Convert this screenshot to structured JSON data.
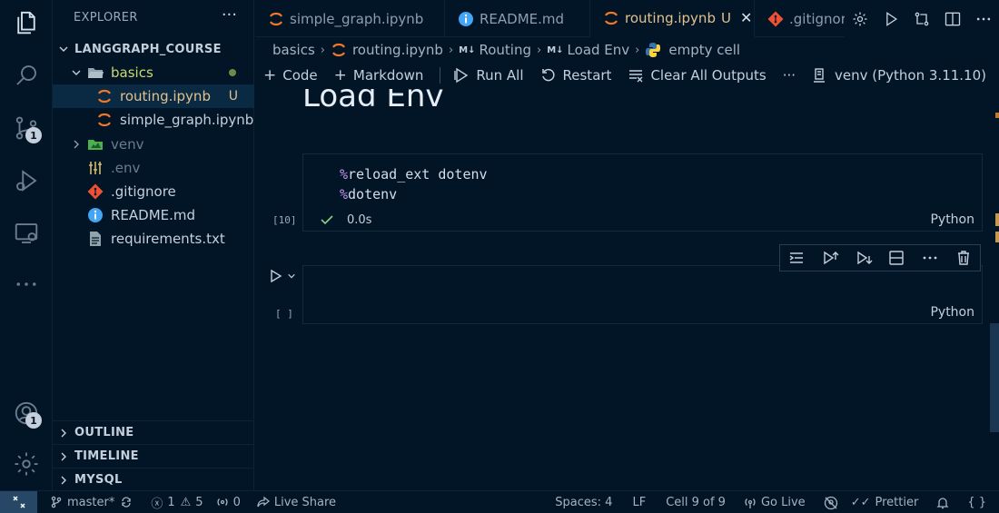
{
  "activity_bar": {
    "source_control_badge": "1",
    "accounts_badge": "1"
  },
  "sidebar": {
    "title": "EXPLORER",
    "root": "LANGGRAPH_COURSE",
    "items": [
      {
        "label": "basics"
      },
      {
        "label": "routing.ipynb",
        "status": "U"
      },
      {
        "label": "simple_graph.ipynb"
      },
      {
        "label": "venv"
      },
      {
        "label": ".env"
      },
      {
        "label": ".gitignore"
      },
      {
        "label": "README.md"
      },
      {
        "label": "requirements.txt"
      }
    ],
    "sections": [
      "OUTLINE",
      "TIMELINE",
      "MYSQL"
    ]
  },
  "tabs": [
    {
      "label": "simple_graph.ipynb"
    },
    {
      "label": "README.md"
    },
    {
      "label": "routing.ipynb",
      "status": "U"
    },
    {
      "label": ".gitignore"
    }
  ],
  "breadcrumb": {
    "folder": "basics",
    "file": "routing.ipynb",
    "md_marker": "M↓",
    "section1": "Routing",
    "section2": "Load Env",
    "cell": "empty cell"
  },
  "notebook_toolbar": {
    "code": "Code",
    "markdown": "Markdown",
    "run_all": "Run All",
    "restart": "Restart",
    "clear_outputs": "Clear All Outputs",
    "more": "···",
    "kernel": "venv (Python 3.11.10)"
  },
  "notebook": {
    "heading": "Load Env",
    "cell1": {
      "line1_magic": "%",
      "line1_rest": "reload_ext dotenv",
      "line2_magic": "%",
      "line2_rest": "dotenv",
      "exec_count": "[10]",
      "exec_time": "0.0s",
      "language": "Python"
    },
    "cell2": {
      "exec_count": "[ ]",
      "language": "Python"
    }
  },
  "statusbar": {
    "branch": "master*",
    "errors": "1",
    "warnings": "5",
    "ports": "0",
    "live_share": "Live Share",
    "spaces": "Spaces: 4",
    "eol": "LF",
    "cell_pos": "Cell 9 of 9",
    "go_live": "Go Live",
    "prettier": "Prettier",
    "braces": "{ }"
  },
  "colors": {
    "background": "#021527",
    "accent": "#264766",
    "untracked": "#e2c08d",
    "magic": "#c792ea"
  }
}
